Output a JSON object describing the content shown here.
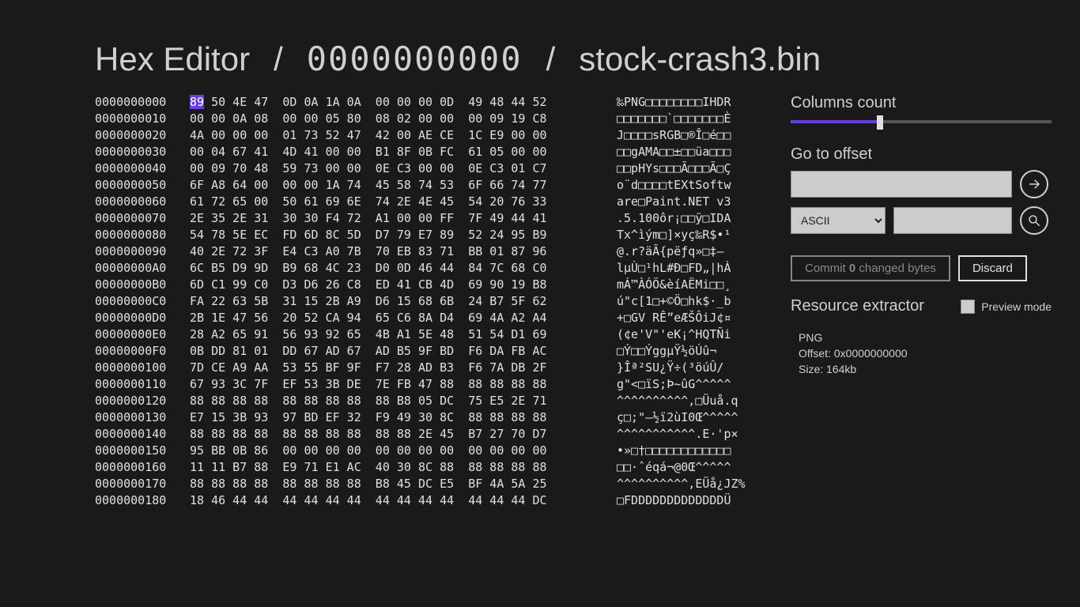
{
  "header": {
    "app": "Hex Editor",
    "sep": "/",
    "offset": "0000000000",
    "file": "stock-crash3.bin"
  },
  "hex": {
    "highlight_row": 0,
    "highlight_col": 0,
    "rows": [
      {
        "o": "0000000000",
        "b": "89 50 4E 47  0D 0A 1A 0A  00 00 00 0D  49 48 44 52",
        "a": "‰PNG□□□□□□□□IHDR"
      },
      {
        "o": "0000000010",
        "b": "00 00 0A 08  00 00 05 80  08 02 00 00  00 09 19 C8",
        "a": "□□□□□□□`□□□□□□□È"
      },
      {
        "o": "0000000020",
        "b": "4A 00 00 00  01 73 52 47  42 00 AE CE  1C E9 00 00",
        "a": "J□□□□sRGB□®Î□é□□"
      },
      {
        "o": "0000000030",
        "b": "00 04 67 41  4D 41 00 00  B1 8F 0B FC  61 05 00 00",
        "a": "□□gAMA□□±□□üa□□□"
      },
      {
        "o": "0000000040",
        "b": "00 09 70 48  59 73 00 00  0E C3 00 00  0E C3 01 C7",
        "a": "□□pHYs□□□Ã□□□Ã□Ç"
      },
      {
        "o": "0000000050",
        "b": "6F A8 64 00  00 00 1A 74  45 58 74 53  6F 66 74 77",
        "a": "o¨d□□□□tEXtSoftw"
      },
      {
        "o": "0000000060",
        "b": "61 72 65 00  50 61 69 6E  74 2E 4E 45  54 20 76 33",
        "a": "are□Paint.NET v3"
      },
      {
        "o": "0000000070",
        "b": "2E 35 2E 31  30 30 F4 72  A1 00 00 FF  7F 49 44 41",
        "a": ".5.100ôr¡□□ÿ□IDA"
      },
      {
        "o": "0000000080",
        "b": "54 78 5E EC  FD 6D 8C 5D  D7 79 E7 89  52 24 95 B9",
        "a": "Tx^ìým□]×yç‰R$•¹"
      },
      {
        "o": "0000000090",
        "b": "40 2E 72 3F  E4 C3 A0 7B  70 EB 83 71  BB 01 87 96",
        "a": "@.r?äÃ{pëƒq»□‡–"
      },
      {
        "o": "00000000A0",
        "b": "6C B5 D9 9D  B9 68 4C 23  D0 0D 46 44  84 7C 68 C0",
        "a": "lµÙ□¹hL#Ð□FD„|hÀ"
      },
      {
        "o": "00000000B0",
        "b": "6D C1 99 C0  D3 D6 26 C8  ED 41 CB 4D  69 90 19 B8",
        "a": "mÁ™ÀÓÖ&èíAËMi□□¸"
      },
      {
        "o": "00000000C0",
        "b": "FA 22 63 5B  31 15 2B A9  D6 15 68 6B  24 B7 5F 62",
        "a": "ú\"c[1□+©Ö□hk$·_b"
      },
      {
        "o": "00000000D0",
        "b": "2B 1E 47 56  20 52 CA 94  65 C6 8A D4  69 4A A2 A4",
        "a": "+□GV RÊ”eÆŠÔiJ¢¤"
      },
      {
        "o": "00000000E0",
        "b": "28 A2 65 91  56 93 92 65  4B A1 5E 48  51 54 D1 69",
        "a": "(¢e'V\"'eK¡^HQTÑi"
      },
      {
        "o": "00000000F0",
        "b": "0B DD 81 01  DD 67 AD 67  AD B5 9F BD  F6 DA FB AC",
        "a": "□Ý□□Ýg­g­µŸ½öÚû¬"
      },
      {
        "o": "0000000100",
        "b": "7D CE A9 AA  53 55 BF 9F  F7 28 AD B3  F6 7A DB 2F",
        "a": "}Îª²SU¿Ÿ÷(­³öúÛ/"
      },
      {
        "o": "0000000110",
        "b": "67 93 3C 7F  EF 53 3B DE  7E FB 47 88  88 88 88 88",
        "a": "g\"<□ïS;Þ~ûG^^^^^"
      },
      {
        "o": "0000000120",
        "b": "88 88 88 88  88 88 88 88  88 B8 05 DC  75 E5 2E 71",
        "a": "^^^^^^^^^^,□Üuå.q"
      },
      {
        "o": "0000000130",
        "b": "E7 15 3B 93  97 BD EF 32  F9 49 30 8C  88 88 88 88",
        "a": "ç□;\"—½ï2ùI0Œ^^^^^"
      },
      {
        "o": "0000000140",
        "b": "88 88 88 88  88 88 88 88  88 88 2E 45  B7 27 70 D7",
        "a": "^^^^^^^^^^^.E·'p×"
      },
      {
        "o": "0000000150",
        "b": "95 BB 0B 86  00 00 00 00  00 00 00 00  00 00 00 00",
        "a": "•»□†□□□□□□□□□□□□"
      },
      {
        "o": "0000000160",
        "b": "11 11 B7 88  E9 71 E1 AC  40 30 8C 88  88 88 88 88",
        "a": "□□·ˆéqá¬@0Œ^^^^^"
      },
      {
        "o": "0000000170",
        "b": "88 88 88 88  88 88 88 88  B8 45 DC E5  BF 4A 5A 25",
        "a": "^^^^^^^^^^,EÜå¿JZ%"
      },
      {
        "o": "0000000180",
        "b": "18 46 44 44  44 44 44 44  44 44 44 44  44 44 44 DC",
        "a": "□FDDDDDDDDDDDDDÜ"
      }
    ]
  },
  "sidebar": {
    "columns_label": "Columns count",
    "goto_label": "Go to offset",
    "search_type": "ASCII",
    "commit_label_prefix": "Commit ",
    "commit_count": "0",
    "commit_label_suffix": " changed bytes",
    "discard_label": "Discard",
    "res_label": "Resource extractor",
    "preview_label": "Preview mode",
    "resource": {
      "type": "PNG",
      "offset_label": "Offset: ",
      "offset": "0x0000000000",
      "size_label": "Size: ",
      "size": "164kb"
    }
  }
}
